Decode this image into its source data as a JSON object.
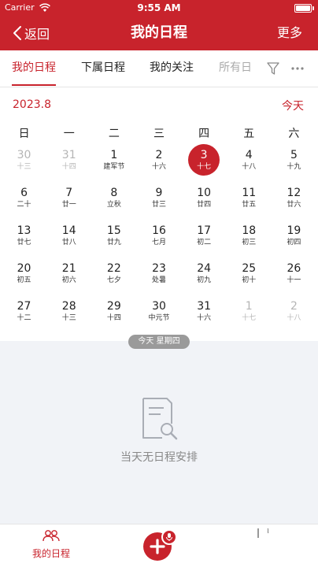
{
  "status": {
    "carrier": "Carrier",
    "time": "9:55 AM"
  },
  "nav": {
    "back_label": "返回",
    "title": "我的日程",
    "more_label": "更多"
  },
  "tabs": [
    {
      "label": "我的日程",
      "active": true
    },
    {
      "label": "下属日程",
      "active": false
    },
    {
      "label": "我的关注",
      "active": false
    },
    {
      "label": "所有日程",
      "active": false
    }
  ],
  "toolbar_icons": [
    "filter-icon",
    "more-dots-icon"
  ],
  "calendar": {
    "month_label": "2023.8",
    "today_button": "今天",
    "weekdays": [
      "日",
      "一",
      "二",
      "三",
      "四",
      "五",
      "六"
    ],
    "weeks": [
      [
        {
          "day": "30",
          "lunar": "十三",
          "muted": true
        },
        {
          "day": "31",
          "lunar": "十四",
          "muted": true
        },
        {
          "day": "1",
          "lunar": "建军节"
        },
        {
          "day": "2",
          "lunar": "十六"
        },
        {
          "day": "3",
          "lunar": "十七",
          "today": true
        },
        {
          "day": "4",
          "lunar": "十八"
        },
        {
          "day": "5",
          "lunar": "十九"
        }
      ],
      [
        {
          "day": "6",
          "lunar": "二十"
        },
        {
          "day": "7",
          "lunar": "廿一"
        },
        {
          "day": "8",
          "lunar": "立秋"
        },
        {
          "day": "9",
          "lunar": "廿三"
        },
        {
          "day": "10",
          "lunar": "廿四"
        },
        {
          "day": "11",
          "lunar": "廿五"
        },
        {
          "day": "12",
          "lunar": "廿六"
        }
      ],
      [
        {
          "day": "13",
          "lunar": "廿七"
        },
        {
          "day": "14",
          "lunar": "廿八"
        },
        {
          "day": "15",
          "lunar": "廿九"
        },
        {
          "day": "16",
          "lunar": "七月"
        },
        {
          "day": "17",
          "lunar": "初二"
        },
        {
          "day": "18",
          "lunar": "初三"
        },
        {
          "day": "19",
          "lunar": "初四"
        }
      ],
      [
        {
          "day": "20",
          "lunar": "初五"
        },
        {
          "day": "21",
          "lunar": "初六"
        },
        {
          "day": "22",
          "lunar": "七夕"
        },
        {
          "day": "23",
          "lunar": "处暑"
        },
        {
          "day": "24",
          "lunar": "初九"
        },
        {
          "day": "25",
          "lunar": "初十"
        },
        {
          "day": "26",
          "lunar": "十一"
        }
      ],
      [
        {
          "day": "27",
          "lunar": "十二"
        },
        {
          "day": "28",
          "lunar": "十三"
        },
        {
          "day": "29",
          "lunar": "十四"
        },
        {
          "day": "30",
          "lunar": "中元节"
        },
        {
          "day": "31",
          "lunar": "十六"
        },
        {
          "day": "1",
          "lunar": "十七",
          "muted": true
        },
        {
          "day": "2",
          "lunar": "十八",
          "muted": true
        }
      ]
    ]
  },
  "today_pill": "今天 星期四",
  "empty": {
    "icon": "document-search-icon",
    "text": "当天无日程安排"
  },
  "bottom": {
    "tab_label": "我的日程",
    "tab_icon": "people-icon",
    "add_icon": "add-icon",
    "mic_icon": "mic-icon"
  },
  "colors": {
    "brand": "#c8232c",
    "empty_bg": "#f1f3f7",
    "muted": "#b5b5b5",
    "pill": "#9a9a9a"
  }
}
